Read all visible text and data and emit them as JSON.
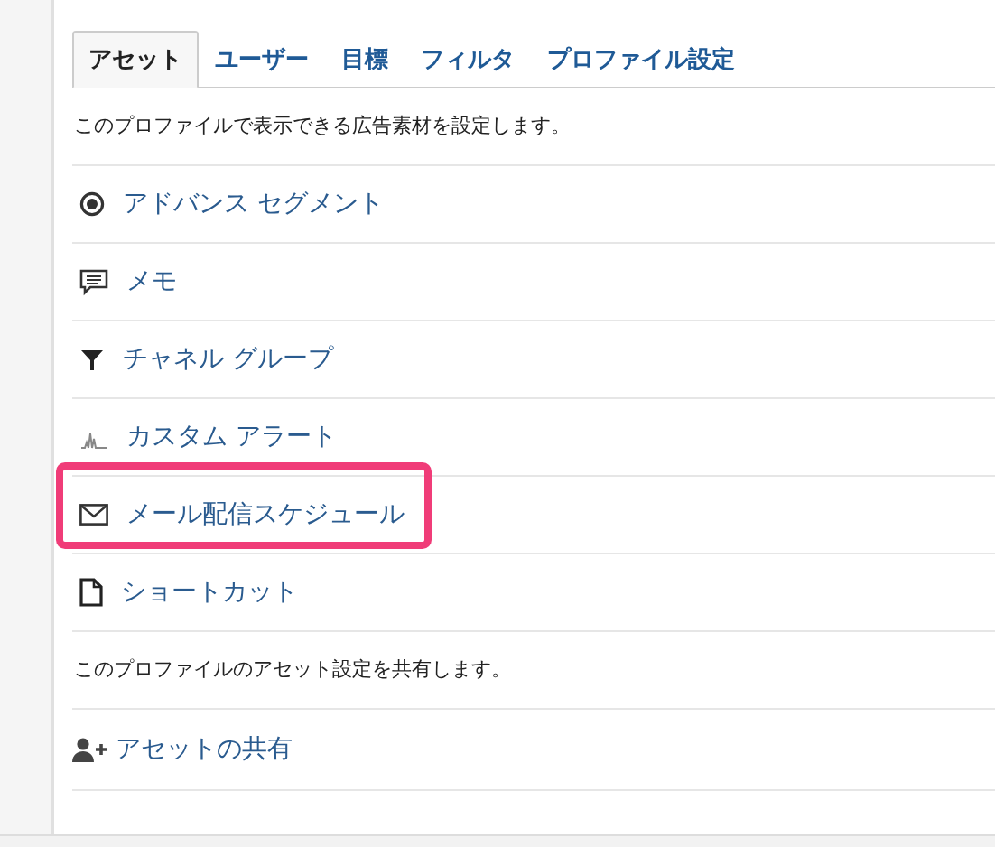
{
  "tabs": [
    {
      "label": "アセット",
      "selected": true
    },
    {
      "label": "ユーザー",
      "selected": false
    },
    {
      "label": "目標",
      "selected": false
    },
    {
      "label": "フィルタ",
      "selected": false
    },
    {
      "label": "プロファイル設定",
      "selected": false
    }
  ],
  "sections": [
    {
      "description": "このプロファイルで表示できる広告素材を設定します。",
      "items": [
        {
          "kind": "segment",
          "label": "アドバンス セグメント",
          "highlighted": false
        },
        {
          "kind": "memo",
          "label": "メモ",
          "highlighted": false
        },
        {
          "kind": "filter",
          "label": "チャネル グループ",
          "highlighted": false
        },
        {
          "kind": "alert",
          "label": "カスタム アラート",
          "highlighted": false
        },
        {
          "kind": "mail",
          "label": "メール配信スケジュール",
          "highlighted": true
        },
        {
          "kind": "shortcut",
          "label": "ショートカット",
          "highlighted": false
        }
      ]
    },
    {
      "description": "このプロファイルのアセット設定を共有します。",
      "items": [
        {
          "kind": "share",
          "label": "アセットの共有",
          "highlighted": false
        }
      ]
    }
  ]
}
